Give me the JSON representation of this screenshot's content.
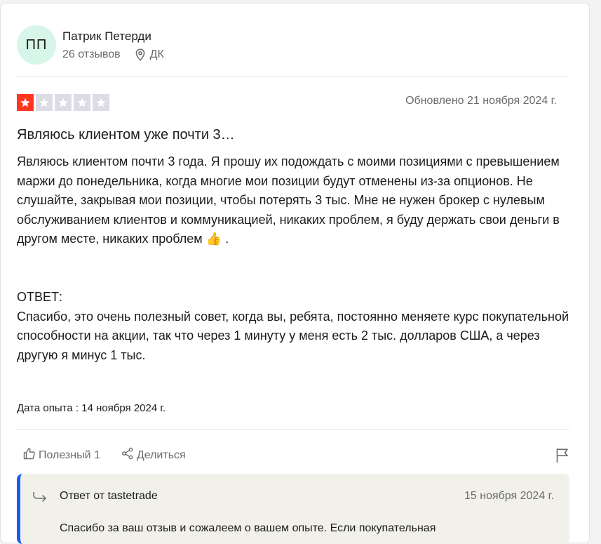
{
  "reviewer": {
    "initials": "ПП",
    "name": "Патрик Петерди",
    "reviews_count": "26 отзывов",
    "country": "ДК"
  },
  "review": {
    "rating": 1,
    "rating_max": 5,
    "updated": "Обновлено 21 ноября 2024 г.",
    "title": "Являюсь клиентом уже почти 3…",
    "body": "Являюсь клиентом почти 3 года. Я прошу их подождать с моими позициями с превышением маржи до понедельника, когда многие мои позиции будут отменены из-за опционов. Не слушайте, закрывая мои позиции, чтобы потерять 3 тыс. Мне не нужен брокер с нулевым обслуживанием клиентов и коммуникацией, никаких проблем, я буду держать свои деньги в другом месте, никаких проблем 👍 .\n\n\nОТВЕТ:\nСпасибо, это очень полезный совет, когда вы, ребята, постоянно меняете курс покупательной способности на акции, так что через 1 минуту у меня есть 2 тыс. долларов США, а через другую я минус 1 тыс.",
    "experience_date": "Дата опыта : 14 ноября 2024 г."
  },
  "actions": {
    "helpful_label": "Полезный 1",
    "share_label": "Делиться"
  },
  "reply": {
    "from": "Ответ от tastetrade",
    "date": "15 ноября 2024 г.",
    "text": "Спасибо за ваш отзыв и сожалеем о вашем опыте. Если покупательная"
  },
  "colors": {
    "star_on": "#ff3722",
    "star_off": "#dcdce6",
    "avatar_bg": "#d7f6e9",
    "reply_bg": "#f1f0e9",
    "reply_accent": "#195bf7"
  },
  "icons": {
    "location": "location-pin-icon",
    "helpful": "thumbs-up-icon",
    "share": "share-icon",
    "flag": "flag-icon",
    "reply": "reply-arrow-icon",
    "star": "star-icon"
  }
}
